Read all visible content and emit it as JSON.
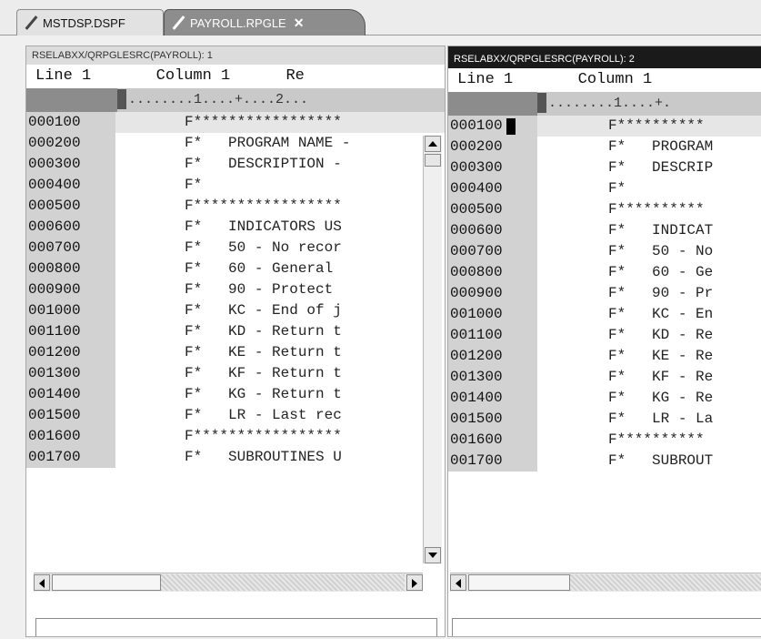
{
  "tabs": [
    {
      "label": "MSTDSP.DSPF",
      "icon": "edit-pencil-icon"
    },
    {
      "label": "PAYROLL.RPGLE",
      "icon": "edit-pencil-icon",
      "close": "✕"
    }
  ],
  "left": {
    "title": "RSELABXX/QRPGLESRC(PAYROLL): 1",
    "header": "Line 1       Column 1      Re",
    "ruler": "........1....+....2...",
    "rows": [
      {
        "seq": "000100",
        "src": "F*****************"
      },
      {
        "seq": "000200",
        "src": "F*   PROGRAM NAME -"
      },
      {
        "seq": "000300",
        "src": "F*   DESCRIPTION -"
      },
      {
        "seq": "000400",
        "src": "F*"
      },
      {
        "seq": "000500",
        "src": "F*****************"
      },
      {
        "seq": "000600",
        "src": "F*   INDICATORS US"
      },
      {
        "seq": "000700",
        "src": "F*   50 - No recor"
      },
      {
        "seq": "000800",
        "src": "F*   60 - General"
      },
      {
        "seq": "000900",
        "src": "F*   90 - Protect"
      },
      {
        "seq": "001000",
        "src": "F*   KC - End of j"
      },
      {
        "seq": "001100",
        "src": "F*   KD - Return t"
      },
      {
        "seq": "001200",
        "src": "F*   KE - Return t"
      },
      {
        "seq": "001300",
        "src": "F*   KF - Return t"
      },
      {
        "seq": "001400",
        "src": "F*   KG - Return t"
      },
      {
        "seq": "001500",
        "src": "F*   LR - Last rec"
      },
      {
        "seq": "001600",
        "src": "F*****************"
      },
      {
        "seq": "001700",
        "src": "F*   SUBROUTINES U"
      }
    ]
  },
  "right": {
    "title": "RSELABXX/QRPGLESRC(PAYROLL): 2",
    "header": "Line 1       Column 1",
    "ruler": "........1....+.",
    "rows": [
      {
        "seq": "000100",
        "src": "F**********"
      },
      {
        "seq": "000200",
        "src": "F*   PROGRAM"
      },
      {
        "seq": "000300",
        "src": "F*   DESCRIP"
      },
      {
        "seq": "000400",
        "src": "F*"
      },
      {
        "seq": "000500",
        "src": "F**********"
      },
      {
        "seq": "000600",
        "src": "F*   INDICAT"
      },
      {
        "seq": "000700",
        "src": "F*   50 - No"
      },
      {
        "seq": "000800",
        "src": "F*   60 - Ge"
      },
      {
        "seq": "000900",
        "src": "F*   90 - Pr"
      },
      {
        "seq": "001000",
        "src": "F*   KC - En"
      },
      {
        "seq": "001100",
        "src": "F*   KD - Re"
      },
      {
        "seq": "001200",
        "src": "F*   KE - Re"
      },
      {
        "seq": "001300",
        "src": "F*   KF - Re"
      },
      {
        "seq": "001400",
        "src": "F*   KG - Re"
      },
      {
        "seq": "001500",
        "src": "F*   LR - La"
      },
      {
        "seq": "001600",
        "src": "F**********"
      },
      {
        "seq": "001700",
        "src": "F*   SUBROUT"
      }
    ]
  }
}
